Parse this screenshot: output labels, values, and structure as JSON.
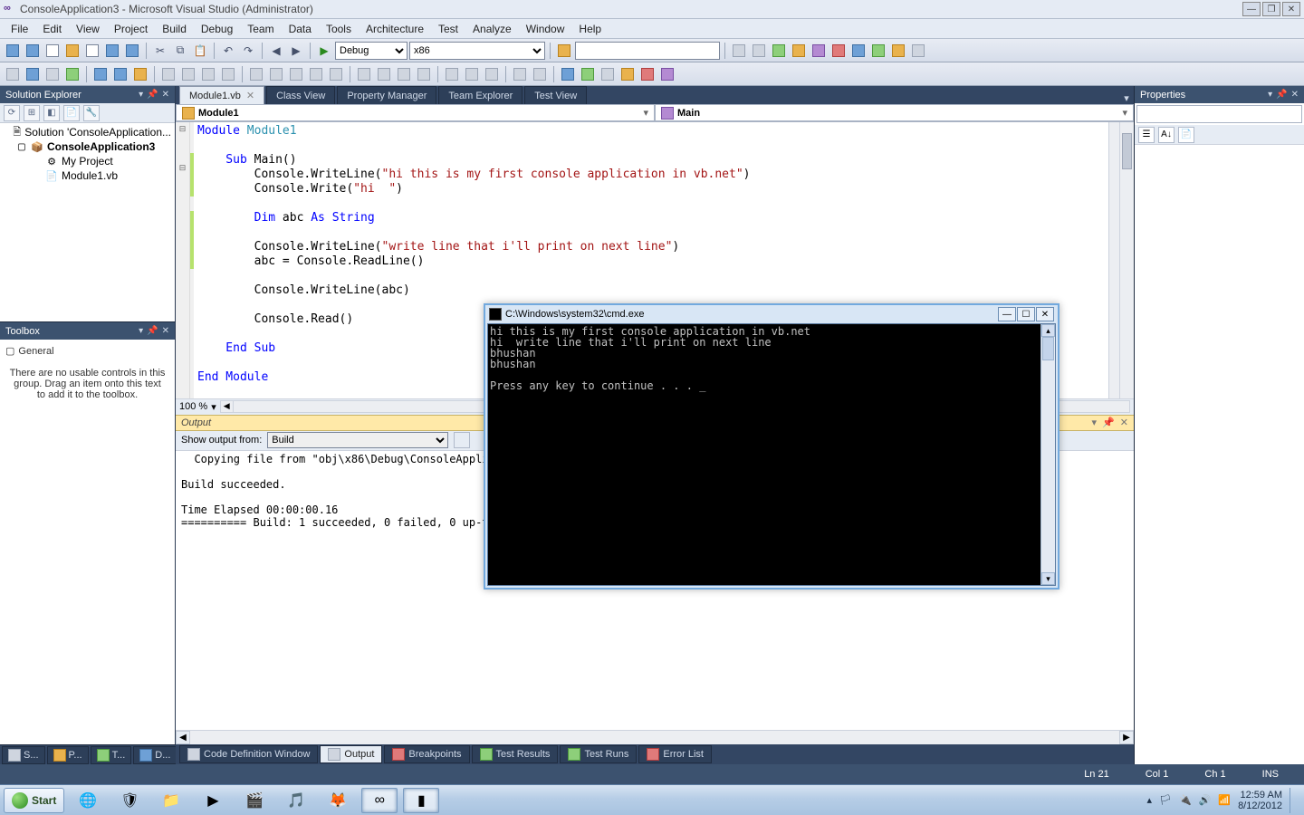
{
  "window": {
    "title": "ConsoleApplication3 - Microsoft Visual Studio (Administrator)"
  },
  "menu": [
    "File",
    "Edit",
    "View",
    "Project",
    "Build",
    "Debug",
    "Team",
    "Data",
    "Tools",
    "Architecture",
    "Test",
    "Analyze",
    "Window",
    "Help"
  ],
  "toolbar1": {
    "config": "Debug",
    "platform": "x86"
  },
  "solution_explorer": {
    "title": "Solution Explorer",
    "root": "Solution 'ConsoleApplication...",
    "project": "ConsoleApplication3",
    "items": [
      "My Project",
      "Module1.vb"
    ]
  },
  "toolbox": {
    "title": "Toolbox",
    "group": "General",
    "empty_text": "There are no usable controls in this group. Drag an item onto this text to add it to the toolbox."
  },
  "properties": {
    "title": "Properties"
  },
  "doc_tabs": [
    "Module1.vb",
    "Class View",
    "Property Manager",
    "Team Explorer",
    "Test View"
  ],
  "nav": {
    "left": "Module1",
    "right": "Main"
  },
  "code": {
    "l1a": "Module",
    "l1b": " Module1",
    "l3a": "    Sub",
    "l3b": " Main()",
    "l4a": "        Console.WriteLine(",
    "l4b": "\"hi this is my first console application in vb.net\"",
    "l4c": ")",
    "l5a": "        Console.Write(",
    "l5b": "\"hi  \"",
    "l5c": ")",
    "l7a": "        Dim",
    "l7b": " abc ",
    "l7c": "As String",
    "l9a": "        Console.WriteLine(",
    "l9b": "\"write line that i'll print on next line\"",
    "l9c": ")",
    "l10": "        abc = Console.ReadLine()",
    "l12": "        Console.WriteLine(abc)",
    "l14": "        Console.Read()",
    "l16a": "    End Sub",
    "l18a": "End Module"
  },
  "zoom": "100 %",
  "output": {
    "title": "Output",
    "label": "Show output from:",
    "source": "Build",
    "body": "  Copying file from \"obj\\x86\\Debug\\ConsoleApplication3.xml\" to \"bin\\Debug\\ConsoleApplication3.xml\".\n\nBuild succeeded.\n\nTime Elapsed 00:00:00.16\n========== Build: 1 succeeded, 0 failed, 0 up-to-date, 0 skipped =========="
  },
  "bottom_tabs": [
    "Code Definition Window",
    "Output",
    "Breakpoints",
    "Test Results",
    "Test Runs",
    "Error List"
  ],
  "side_tabs": [
    "S...",
    "P...",
    "T...",
    "D..."
  ],
  "status": {
    "ln": "Ln 21",
    "col": "Col 1",
    "ch": "Ch 1",
    "ins": "INS"
  },
  "cmd": {
    "title": "C:\\Windows\\system32\\cmd.exe",
    "body": "hi this is my first console application in vb.net\nhi  write line that i'll print on next line\nbhushan\nbhushan\n\nPress any key to continue . . . _"
  },
  "taskbar": {
    "start": "Start",
    "time": "12:59 AM",
    "date": "8/12/2012"
  }
}
